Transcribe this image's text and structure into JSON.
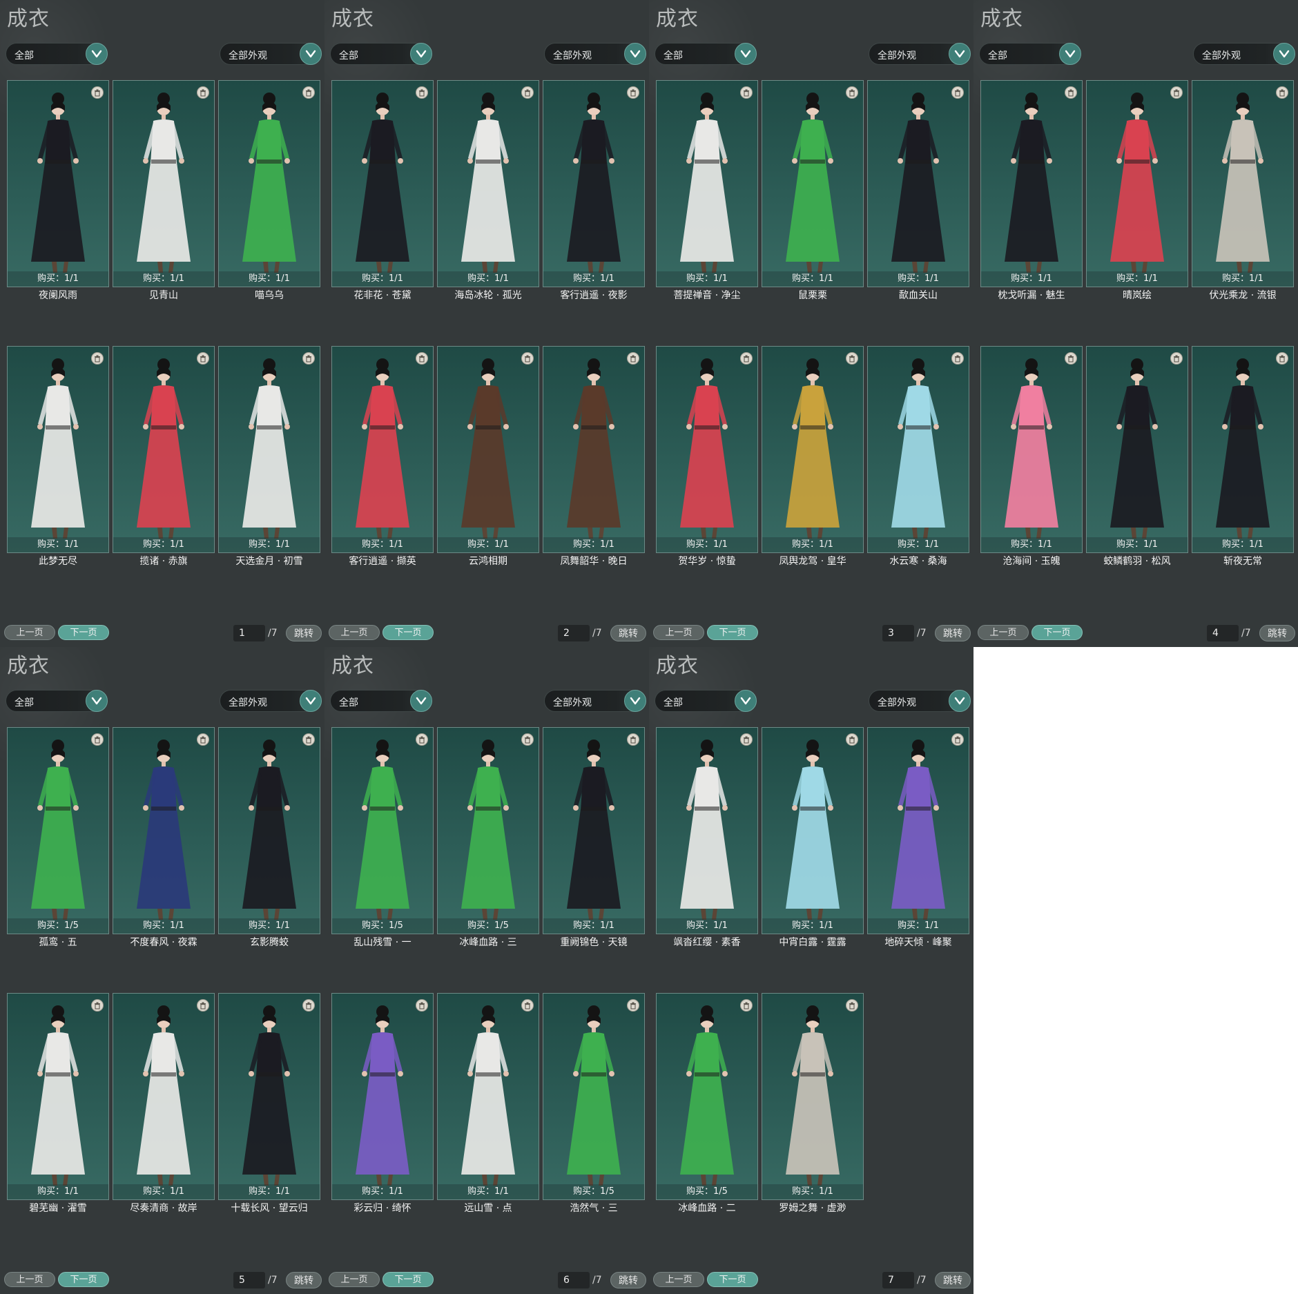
{
  "common": {
    "title": "成衣",
    "filter_left": "全部",
    "filter_right": "全部外观",
    "prev_label": "上一页",
    "next_label": "下一页",
    "jump_label": "跳转",
    "page_total": "/7"
  },
  "palette": [
    "#1b1b22",
    "#e8e8e6",
    "#3eb04f",
    "#d94250",
    "#c9a23c",
    "#9fd9e6",
    "#f07fa0",
    "#7a5cc4",
    "#5a3a2a",
    "#2a3a7a",
    "#c8c2b8"
  ],
  "panels": [
    {
      "page": "1",
      "cards": [
        {
          "name": "夜阑风雨",
          "buy": "购买：1/1",
          "outfit": 0
        },
        {
          "name": "见青山",
          "buy": "购买：1/1",
          "outfit": 1
        },
        {
          "name": "喵乌乌",
          "buy": "购买：1/1",
          "outfit": 2
        },
        {
          "name": "此梦无尽",
          "buy": "购买：1/1",
          "outfit": 1
        },
        {
          "name": "揽诸 · 赤旗",
          "buy": "购买：1/1",
          "outfit": 3
        },
        {
          "name": "天选金月 · 初雪",
          "buy": "购买：1/1",
          "outfit": 1
        }
      ]
    },
    {
      "page": "2",
      "cards": [
        {
          "name": "花非花 · 苍黛",
          "buy": "购买：1/1",
          "outfit": 0
        },
        {
          "name": "海岛冰轮 · 孤光",
          "buy": "购买：1/1",
          "outfit": 1
        },
        {
          "name": "客行逍遥 · 夜影",
          "buy": "购买：1/1",
          "outfit": 0
        },
        {
          "name": "客行逍遥 · 撷英",
          "buy": "购买：1/1",
          "outfit": 3
        },
        {
          "name": "云鸿相期",
          "buy": "购买：1/1",
          "outfit": 8
        },
        {
          "name": "凤舞韶华 · 晚日",
          "buy": "购买：1/1",
          "outfit": 8
        }
      ]
    },
    {
      "page": "3",
      "cards": [
        {
          "name": "菩提禅音 · 净尘",
          "buy": "购买：1/1",
          "outfit": 1
        },
        {
          "name": "鼠栗栗",
          "buy": "购买：1/1",
          "outfit": 2
        },
        {
          "name": "歃血关山",
          "buy": "购买：1/1",
          "outfit": 0
        },
        {
          "name": "贺华岁 · 惊蛰",
          "buy": "购买：1/1",
          "outfit": 3
        },
        {
          "name": "凤舆龙驾 · 皇华",
          "buy": "购买：1/1",
          "outfit": 4
        },
        {
          "name": "水云寒 · 桑海",
          "buy": "购买：1/1",
          "outfit": 5
        }
      ]
    },
    {
      "page": "4",
      "cards": [
        {
          "name": "枕戈听漏 · 魅生",
          "buy": "购买：1/1",
          "outfit": 0
        },
        {
          "name": "晴岚绘",
          "buy": "购买：1/1",
          "outfit": 3
        },
        {
          "name": "伏光乘龙 · 流银",
          "buy": "购买：1/1",
          "outfit": 10
        },
        {
          "name": "沧海间 · 玉魄",
          "buy": "购买：1/1",
          "outfit": 6
        },
        {
          "name": "蛟鳞鹤羽 · 松风",
          "buy": "购买：1/1",
          "outfit": 0
        },
        {
          "name": "斩夜无常",
          "buy": "购买：1/1",
          "outfit": 0
        }
      ]
    },
    {
      "page": "5",
      "cards": [
        {
          "name": "孤鸾 · 五",
          "buy": "购买：1/5",
          "outfit": 2
        },
        {
          "name": "不度春风 · 夜霖",
          "buy": "购买：1/1",
          "outfit": 9
        },
        {
          "name": "玄影腾蛟",
          "buy": "购买：1/1",
          "outfit": 0
        },
        {
          "name": "碧芜幽 · 濯雪",
          "buy": "购买：1/1",
          "outfit": 1
        },
        {
          "name": "尽奏清商 · 故岸",
          "buy": "购买：1/1",
          "outfit": 1
        },
        {
          "name": "十载长风 · 望云归",
          "buy": "购买：1/1",
          "outfit": 0
        }
      ]
    },
    {
      "page": "6",
      "cards": [
        {
          "name": "乱山残雪 · 一",
          "buy": "购买：1/5",
          "outfit": 2
        },
        {
          "name": "冰峰血路 · 三",
          "buy": "购买：1/5",
          "outfit": 2
        },
        {
          "name": "重阙锦色 · 天镜",
          "buy": "购买：1/1",
          "outfit": 0
        },
        {
          "name": "彩云归 · 绮怀",
          "buy": "购买：1/1",
          "outfit": 7
        },
        {
          "name": "远山雪 · 点",
          "buy": "购买：1/1",
          "outfit": 1
        },
        {
          "name": "浩然气 · 三",
          "buy": "购买：1/5",
          "outfit": 2
        }
      ]
    },
    {
      "page": "7",
      "cards": [
        {
          "name": "飒沓红缨 · 素香",
          "buy": "购买：1/1",
          "outfit": 1
        },
        {
          "name": "中宵白露 · 霆露",
          "buy": "购买：1/1",
          "outfit": 5
        },
        {
          "name": "地碎天倾 · 峰聚",
          "buy": "购买：1/1",
          "outfit": 7
        },
        {
          "name": "冰峰血路 · 二",
          "buy": "购买：1/5",
          "outfit": 2
        },
        {
          "name": "罗姆之舞 · 虚渺",
          "buy": "购买：1/1",
          "outfit": 10
        }
      ]
    }
  ]
}
